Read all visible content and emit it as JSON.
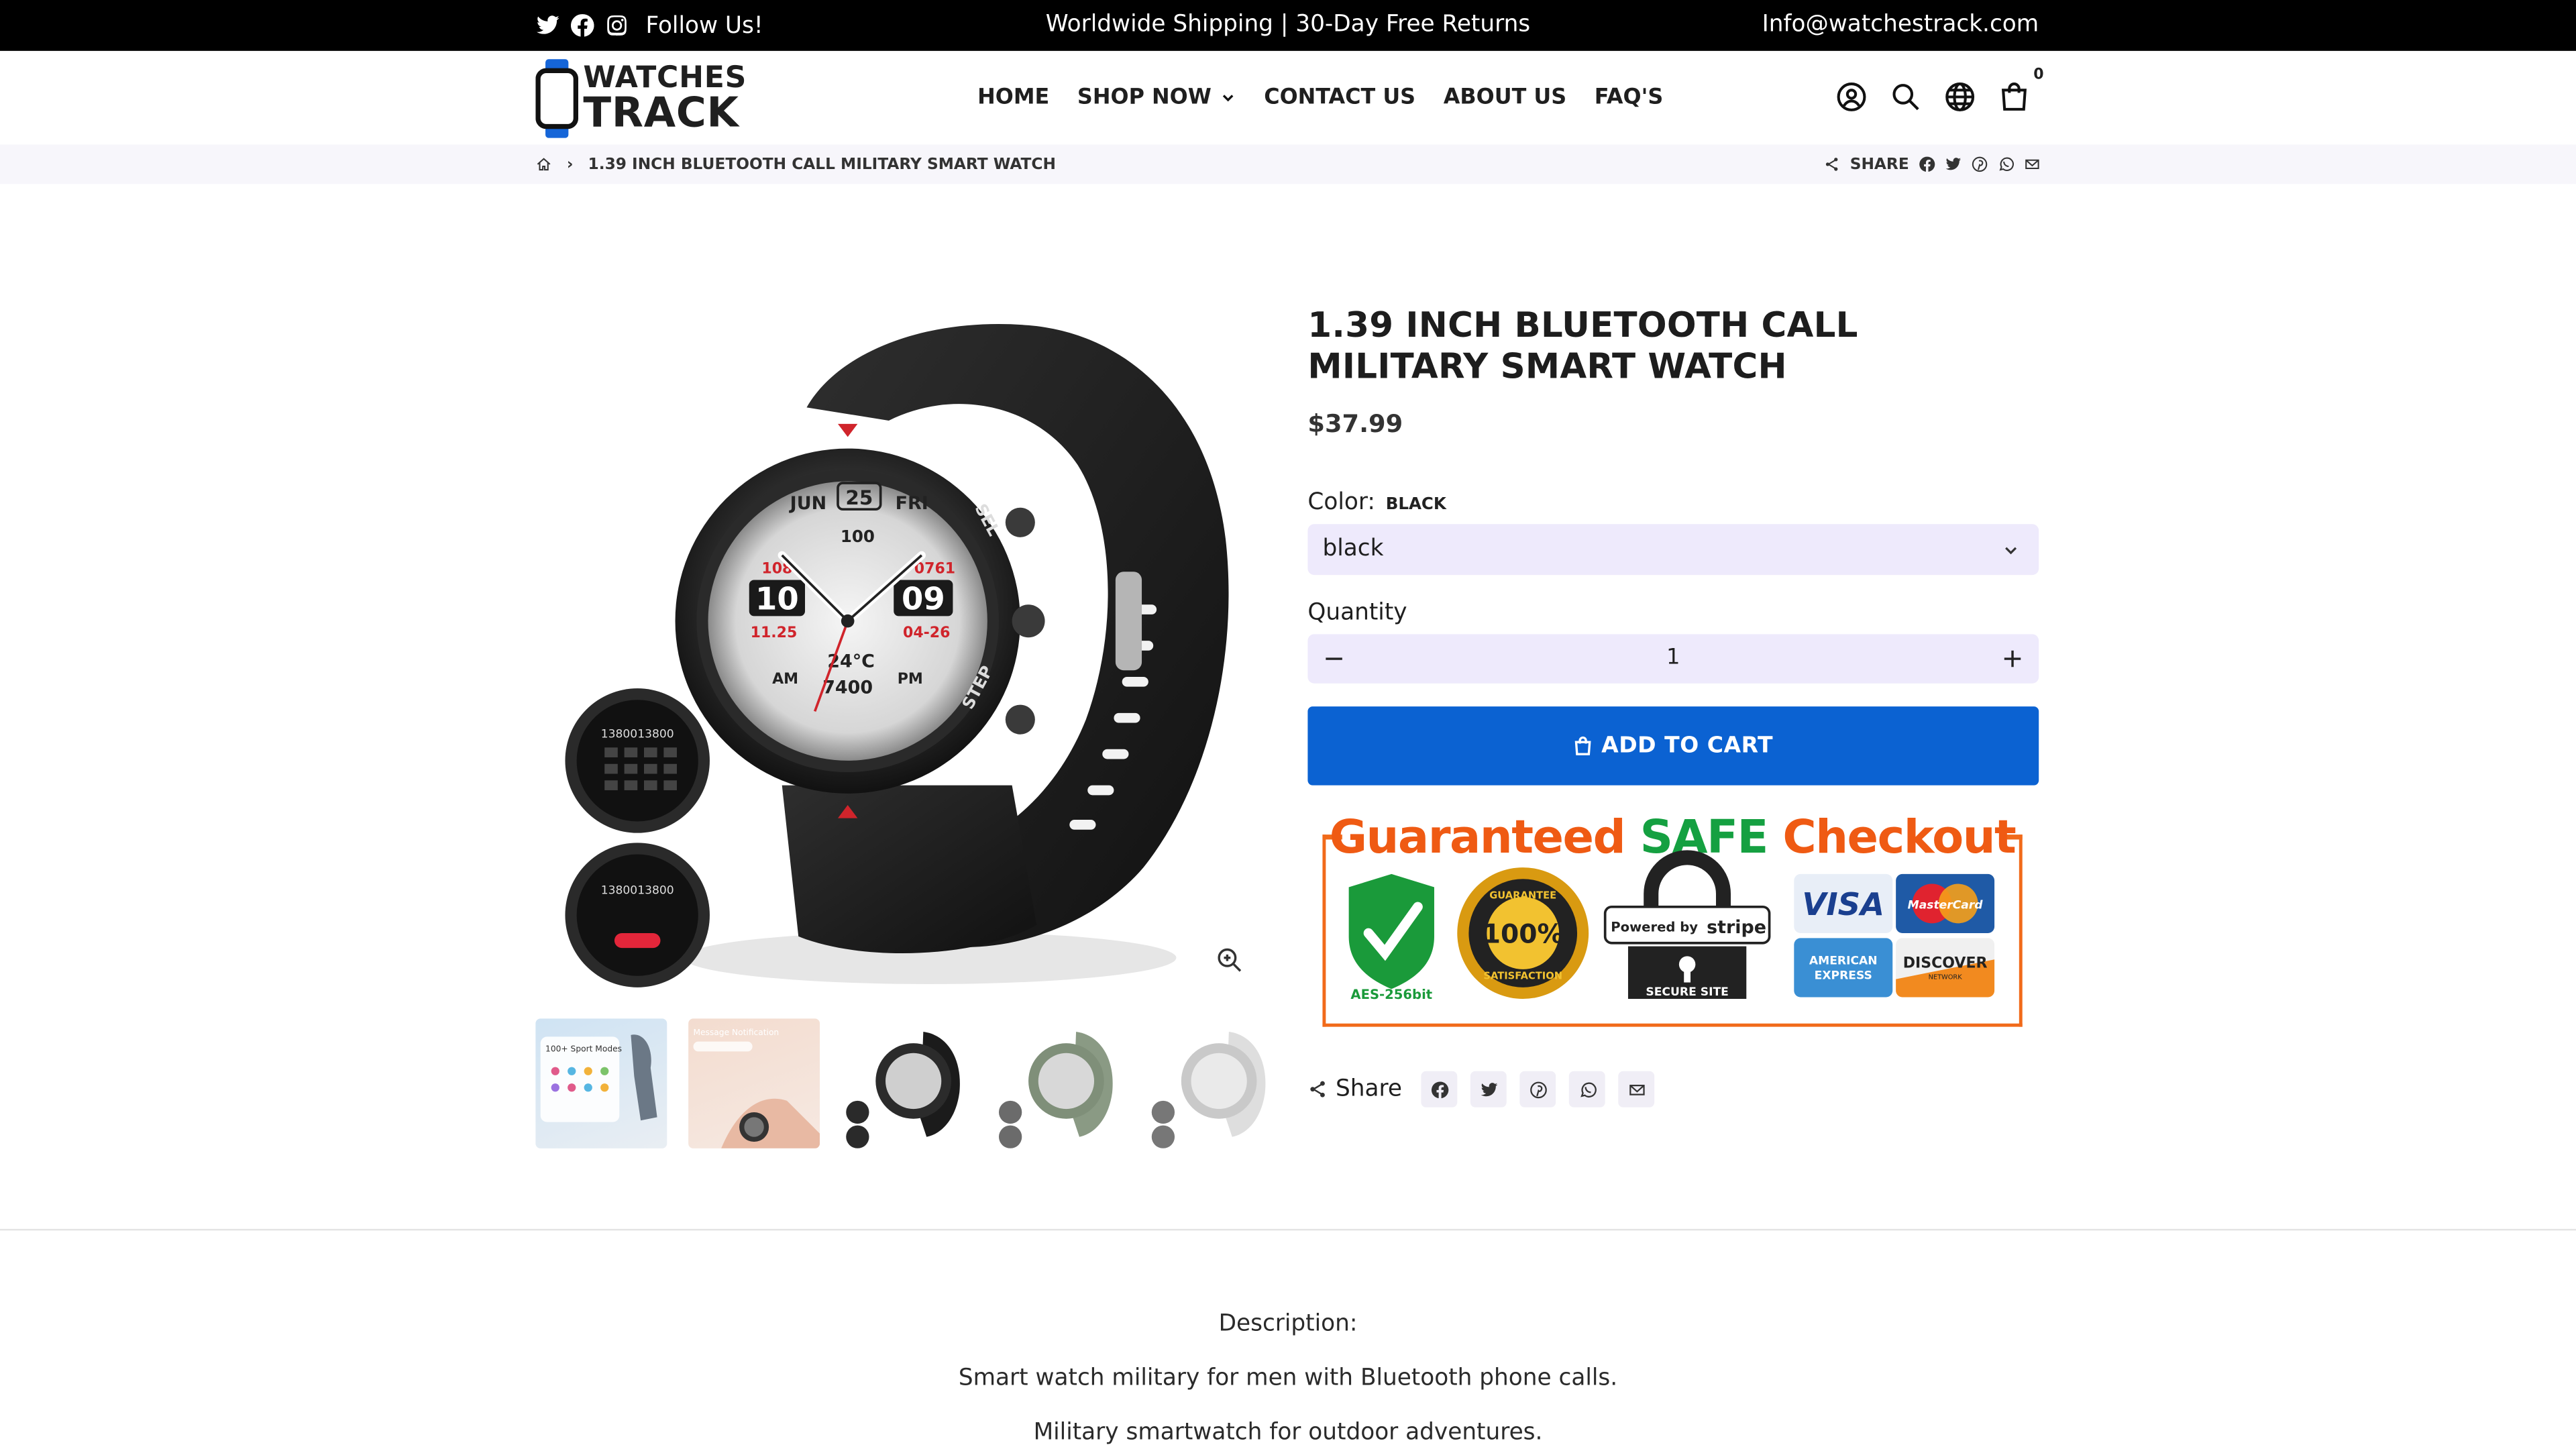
{
  "topbar": {
    "follow_text": "Follow Us!",
    "announcement": "Worldwide Shipping | 30-Day Free Returns",
    "email": "Info@watchestrack.com"
  },
  "logo": {
    "line1": "WATCHES",
    "line2": "TRACK"
  },
  "nav": {
    "items": [
      {
        "label": "HOME"
      },
      {
        "label": "SHOP NOW"
      },
      {
        "label": "CONTACT US"
      },
      {
        "label": "ABOUT US"
      },
      {
        "label": "FAQ'S"
      }
    ]
  },
  "cart": {
    "count": "0"
  },
  "breadcrumb": {
    "current": "1.39 INCH BLUETOOTH CALL MILITARY SMART WATCH",
    "share_label": "SHARE"
  },
  "product": {
    "title": "1.39 INCH BLUETOOTH CALL MILITARY SMART WATCH",
    "price": "$37.99",
    "color_label": "Color:",
    "color_value": "BLACK",
    "select_value": "black",
    "quantity_label": "Quantity",
    "quantity": "1",
    "add_to_cart": "ADD TO CART",
    "watch_face": {
      "month": "JUN",
      "date": "25",
      "day": "FRI",
      "hour": "10",
      "minute": "09",
      "temp": "24°C",
      "steps": "7400",
      "left_num": "108",
      "right_num": "0761",
      "date_left": "11.25",
      "date_right": "04-26",
      "am": "AM",
      "pm": "PM",
      "battery": "100",
      "sel": "SEL",
      "step": "STEP"
    },
    "call_number": "1380013800",
    "thumb_labels": {
      "t1": "100+ Sport Modes",
      "t2": "Message Notification"
    }
  },
  "safe_checkout": {
    "heading_1": "Guaranteed",
    "heading_2": "SAFE",
    "heading_3": "Checkout",
    "aes": "AES-256bit",
    "seal_top": "GUARANTEE",
    "seal_mid": "100%",
    "seal_bottom": "SATISFACTION",
    "powered": "Powered by",
    "stripe": "stripe",
    "secure": "SECURE SITE",
    "visa": "VISA",
    "mastercard": "MasterCard",
    "amex_1": "AMERICAN",
    "amex_2": "EXPRESS",
    "discover": "DISCOVER",
    "network": "NETWORK"
  },
  "share": {
    "label": "Share"
  },
  "description": {
    "heading": "Description:",
    "line1": "Smart watch military for men with Bluetooth phone calls.",
    "line2": "Military smartwatch for outdoor adventures."
  }
}
